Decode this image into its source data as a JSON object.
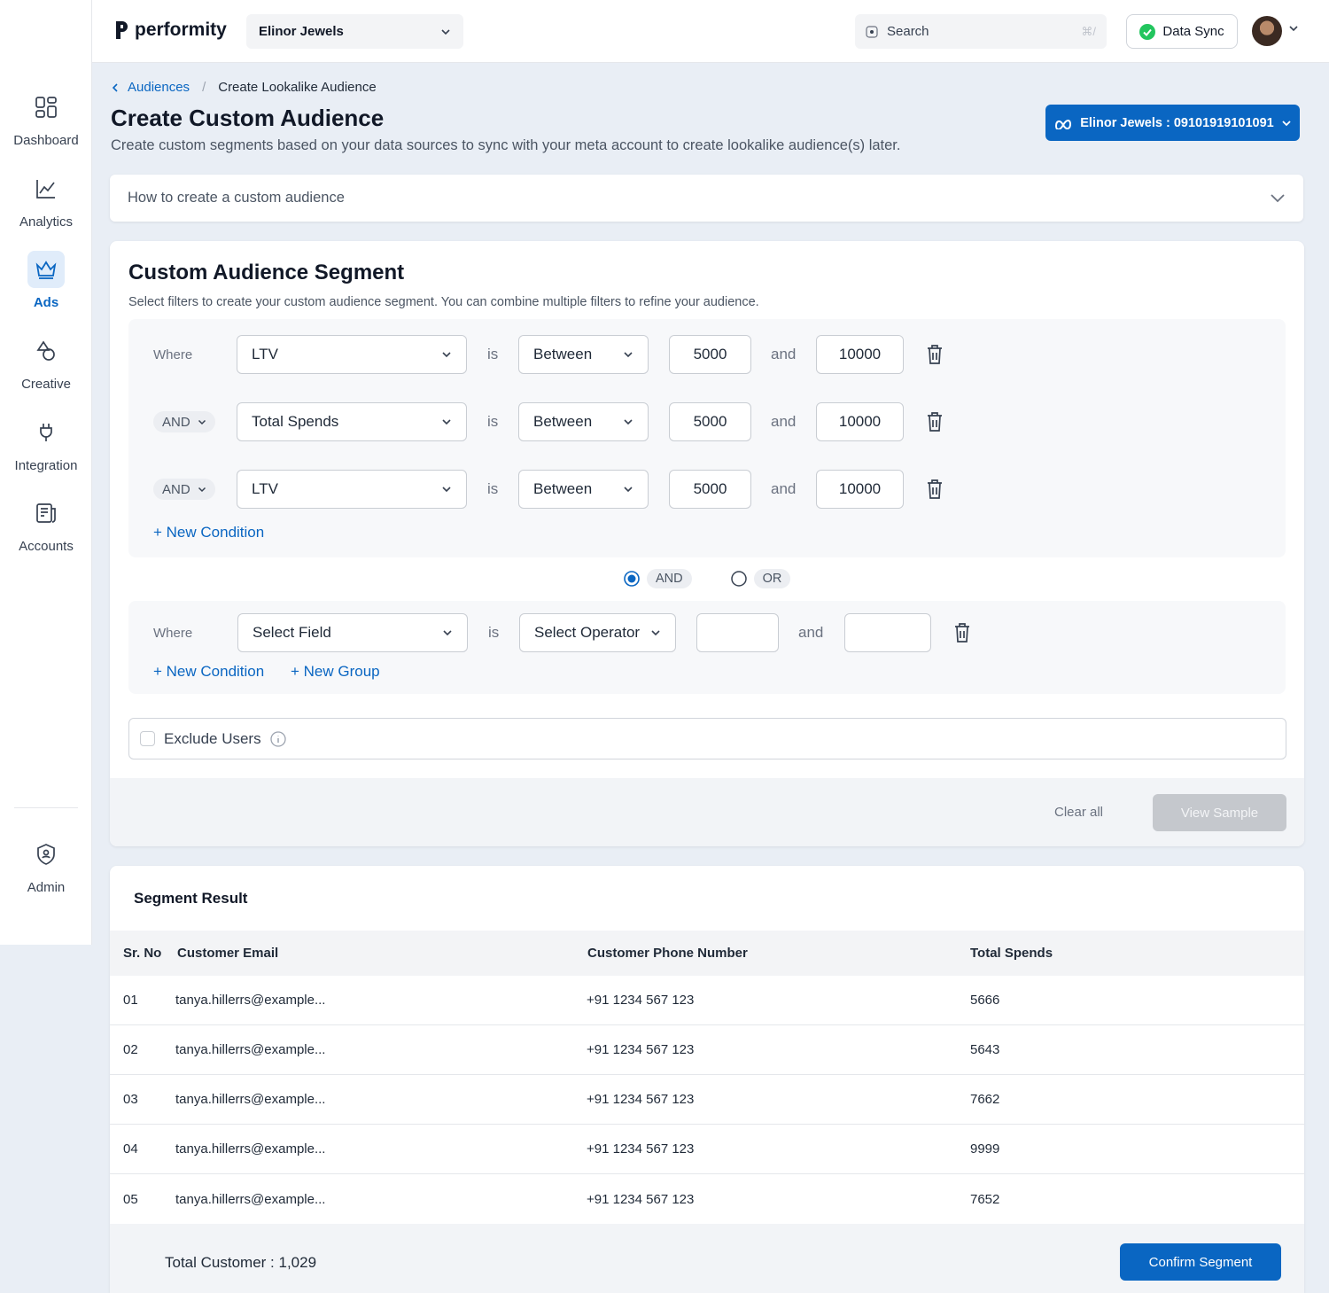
{
  "brand": {
    "logo_text": "performity",
    "workspace": "Elinor Jewels"
  },
  "topbar": {
    "search_placeholder": "Search",
    "search_shortcut": "⌘/",
    "sync_label": "Data Sync"
  },
  "sidebar": {
    "items": [
      {
        "label": "Dashboard",
        "icon": "dashboard-icon"
      },
      {
        "label": "Analytics",
        "icon": "analytics-icon"
      },
      {
        "label": "Ads",
        "icon": "crown-icon",
        "active": true
      },
      {
        "label": "Creative",
        "icon": "creative-icon"
      },
      {
        "label": "Integration",
        "icon": "plug-icon"
      },
      {
        "label": "Accounts",
        "icon": "accounts-icon"
      }
    ],
    "admin_label": "Admin"
  },
  "breadcrumb": {
    "parent": "Audiences",
    "current": "Create Lookalike Audience"
  },
  "header": {
    "title": "Create Custom Audience",
    "subtitle": "Create custom segments based on your data sources to sync with your meta account to create lookalike audience(s) later.",
    "meta_account": "Elinor Jewels : 09101919101091"
  },
  "howto": {
    "label": "How to create a custom audience"
  },
  "segment": {
    "title": "Custom Audience Segment",
    "subtitle": "Select filters to create your custom audience segment. You can combine multiple filters to refine your audience.",
    "group1": {
      "rows": [
        {
          "prefix": "Where",
          "field": "LTV",
          "is": "is",
          "operator": "Between",
          "min": "5000",
          "and": "and",
          "max": "10000"
        },
        {
          "prefix": "AND",
          "field": "Total Spends",
          "is": "is",
          "operator": "Between",
          "min": "5000",
          "and": "and",
          "max": "10000"
        },
        {
          "prefix": "AND",
          "field": "LTV",
          "is": "is",
          "operator": "Between",
          "min": "5000",
          "and": "and",
          "max": "10000"
        }
      ],
      "new_condition": "+ New Condition"
    },
    "combinator": {
      "and": "AND",
      "or": "OR",
      "selected": "AND"
    },
    "group2": {
      "row": {
        "prefix": "Where",
        "field": "Select Field",
        "is": "is",
        "operator": "Select Operator",
        "min": "",
        "and": "and",
        "max": ""
      },
      "new_condition": "+ New Condition",
      "new_group": "+ New Group"
    },
    "exclude_label": "Exclude Users",
    "clear_all": "Clear all",
    "view_sample": "View Sample"
  },
  "result": {
    "title": "Segment Result",
    "columns": [
      "Sr. No",
      "Customer Email",
      "Customer Phone Number",
      "Total Spends"
    ],
    "rows": [
      [
        "01",
        "tanya.hillerrs@example...",
        "+91 1234 567 123",
        "5666"
      ],
      [
        "02",
        "tanya.hillerrs@example...",
        "+91 1234 567 123",
        "5643"
      ],
      [
        "03",
        "tanya.hillerrs@example...",
        "+91 1234 567 123",
        "7662"
      ],
      [
        "04",
        "tanya.hillerrs@example...",
        "+91 1234 567 123",
        "9999"
      ],
      [
        "05",
        "tanya.hillerrs@example...",
        "+91 1234 567 123",
        "7652"
      ]
    ],
    "total": "Total Customer : 1,029",
    "confirm": "Confirm Segment"
  },
  "colors": {
    "primary": "#0a66c2",
    "success": "#22c55e",
    "background": "#e9eef5"
  }
}
